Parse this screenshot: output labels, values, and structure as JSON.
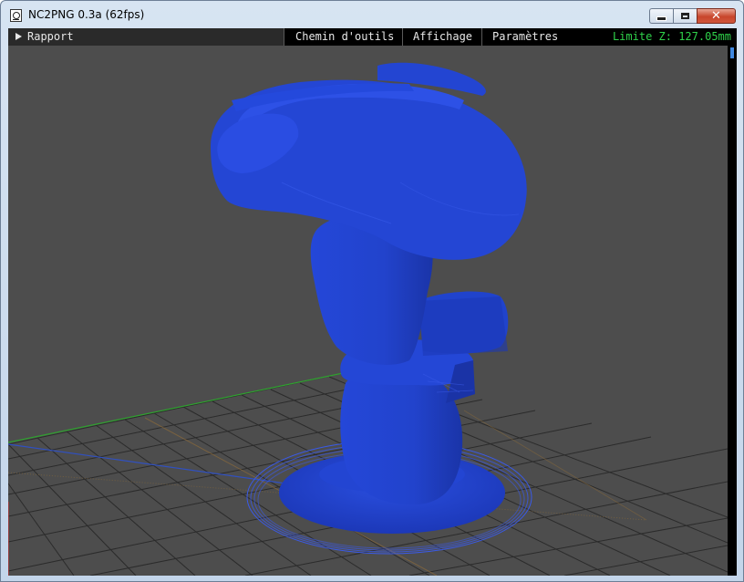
{
  "window": {
    "title": "NC2PNG 0.3a (62fps)",
    "icon": "document-icon"
  },
  "menubar": {
    "rapport_label": "Rapport",
    "items": [
      "Chemin d'outils",
      "Affichage",
      "Paramètres"
    ],
    "limit_text": "Limite Z: 127.05mm"
  },
  "colors": {
    "model_blue": "#2446d4",
    "grid_line": "#2b2b2b",
    "background": "#4d4d4d",
    "axis_x": "#c03030",
    "axis_y": "#30a030",
    "axis_z": "#3050c0",
    "limit_text": "#2fd14a"
  }
}
